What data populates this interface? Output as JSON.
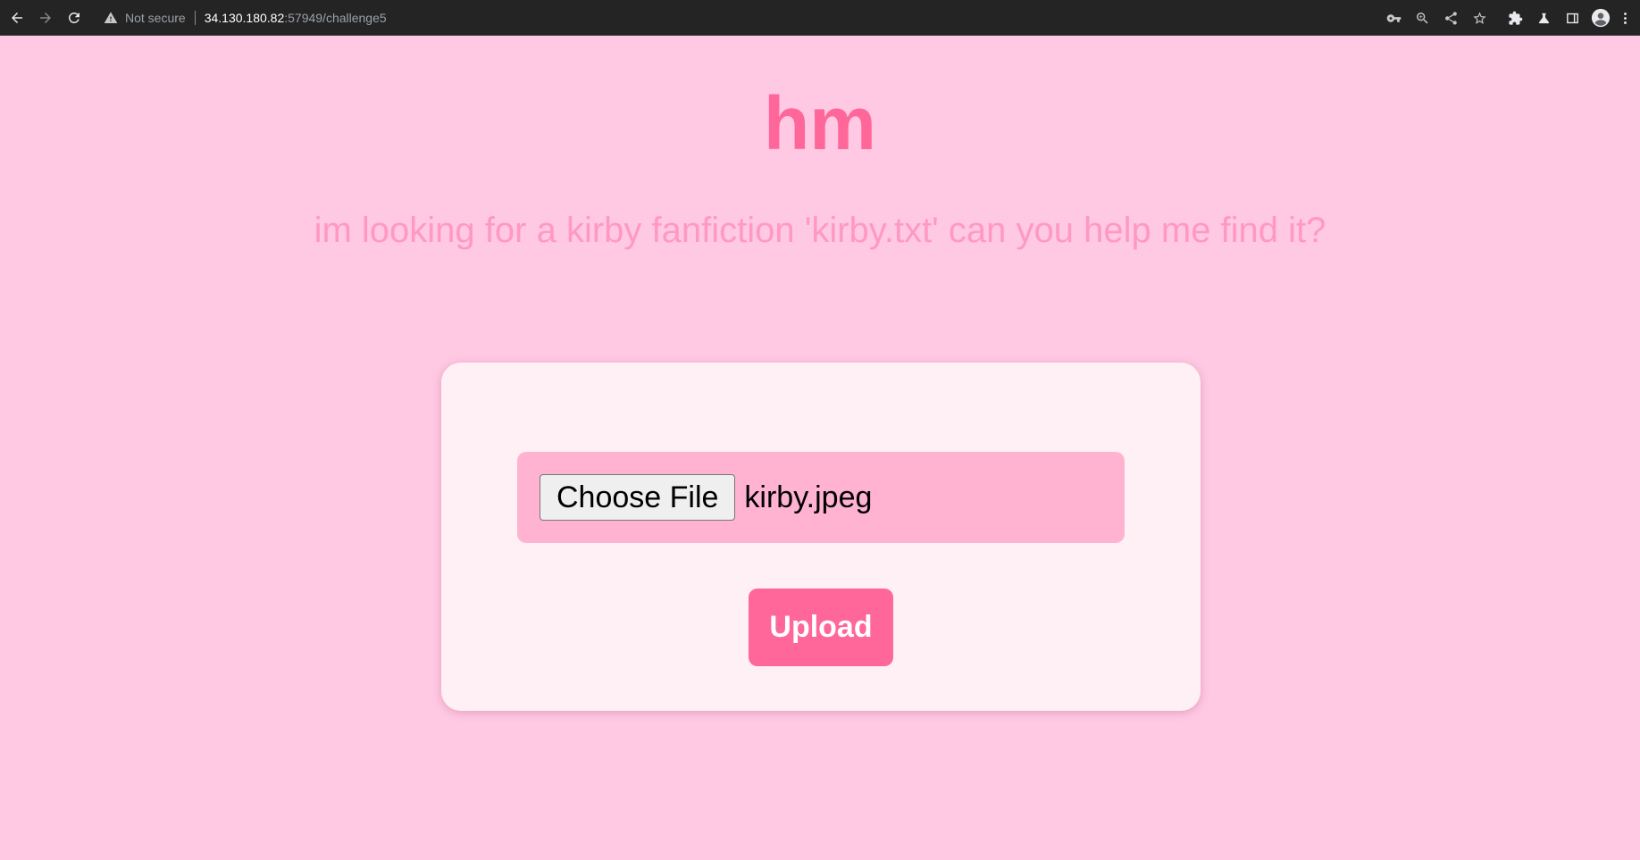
{
  "browser": {
    "security_label": "Not secure",
    "url_host": "34.130.180.82",
    "url_path": ":57949/challenge5",
    "icons": [
      "back-icon",
      "forward-icon",
      "reload-icon",
      "warning-icon",
      "key-icon",
      "zoom-icon",
      "share-icon",
      "star-icon",
      "extensions-icon",
      "labs-icon",
      "side-panel-icon",
      "profile-icon",
      "menu-icon"
    ]
  },
  "page": {
    "title": "hm",
    "subtitle": "im looking for a kirby fanfiction 'kirby.txt' can you help me find it?",
    "choose_file_label": "Choose File",
    "selected_file": "kirby.jpeg",
    "upload_label": "Upload"
  },
  "colors": {
    "background": "#ffc9e3",
    "title": "#ff6699",
    "subtitle": "#ff99c2",
    "card": "#fff0f5",
    "file_box": "#ffb3d0",
    "upload_button": "#ff6699"
  }
}
